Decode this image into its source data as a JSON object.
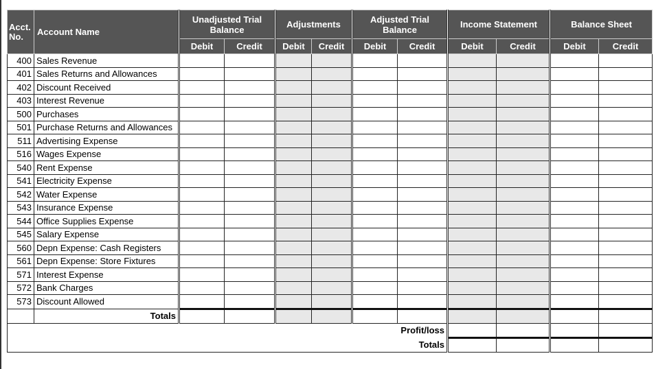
{
  "headers": {
    "acct_no": "Acct. No.",
    "account_name": "Account Name",
    "groups": [
      "Unadjusted Trial Balance",
      "Adjustments",
      "Adjusted Trial Balance",
      "Income Statement",
      "Balance Sheet"
    ],
    "debit": "Debit",
    "credit": "Credit"
  },
  "accounts": [
    {
      "no": "400",
      "name": "Sales Revenue"
    },
    {
      "no": "401",
      "name": "Sales Returns and Allowances"
    },
    {
      "no": "402",
      "name": "Discount Received"
    },
    {
      "no": "403",
      "name": "Interest Revenue"
    },
    {
      "no": "500",
      "name": "Purchases"
    },
    {
      "no": "501",
      "name": "Purchase Returns and Allowances"
    },
    {
      "no": "511",
      "name": "Advertising Expense"
    },
    {
      "no": "516",
      "name": "Wages Expense"
    },
    {
      "no": "540",
      "name": "Rent Expense"
    },
    {
      "no": "541",
      "name": "Electricity Expense"
    },
    {
      "no": "542",
      "name": "Water Expense"
    },
    {
      "no": "543",
      "name": "Insurance Expense"
    },
    {
      "no": "544",
      "name": "Office Supplies Expense"
    },
    {
      "no": "545",
      "name": "Salary Expense"
    },
    {
      "no": "560",
      "name": "Depn Expense: Cash Registers"
    },
    {
      "no": "561",
      "name": "Depn Expense: Store Fixtures"
    },
    {
      "no": "571",
      "name": "Interest Expense"
    },
    {
      "no": "572",
      "name": "Bank Charges"
    },
    {
      "no": "573",
      "name": "Discount Allowed"
    }
  ],
  "footer": {
    "totals": "Totals",
    "profit_loss": "Profit/loss",
    "final_totals": "Totals"
  },
  "colors": {
    "header_bg": "#555555",
    "shaded": "#e8e8e8"
  }
}
